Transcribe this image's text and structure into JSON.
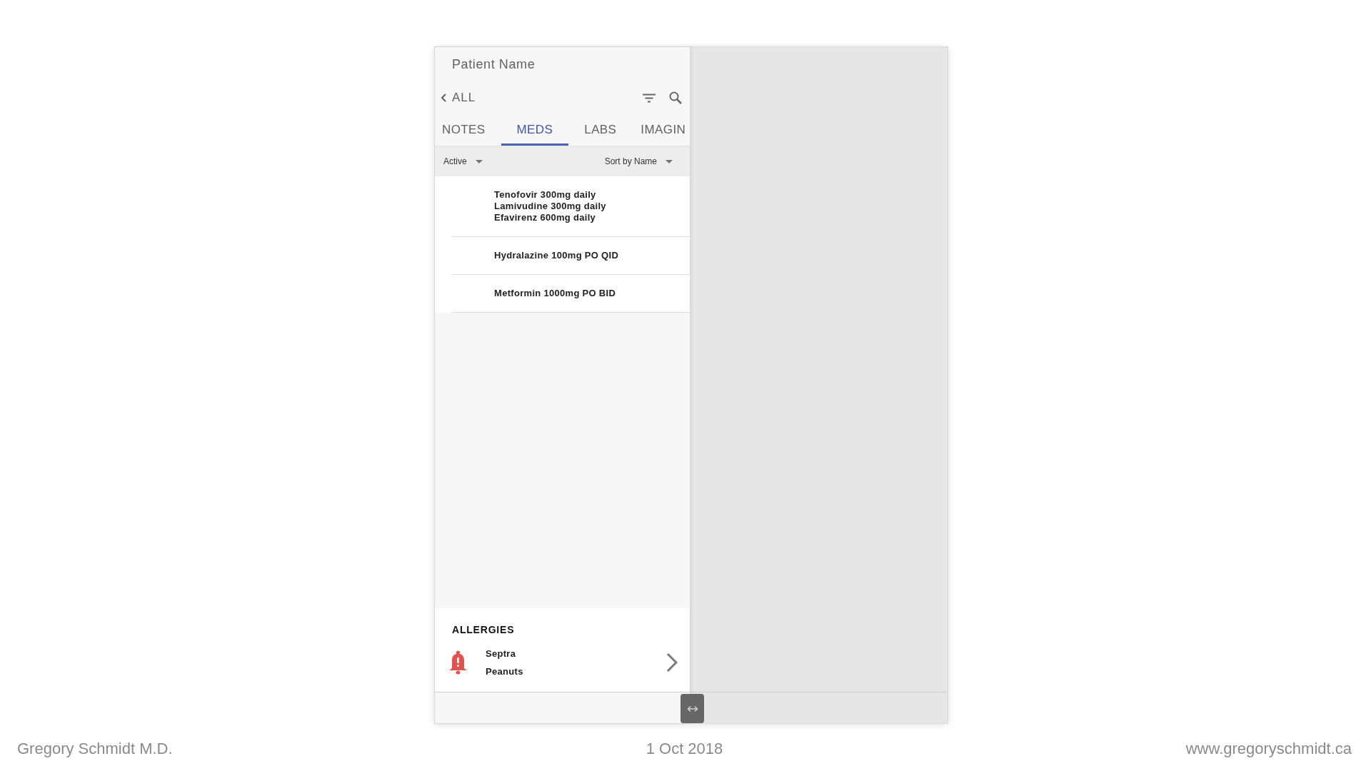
{
  "header": {
    "title": "Patient Name"
  },
  "toolbar": {
    "back_label": "ALL"
  },
  "tabs": [
    {
      "label": "NOTES",
      "selected": false
    },
    {
      "label": "MEDS",
      "selected": true
    },
    {
      "label": "LABS",
      "selected": false
    },
    {
      "label": "IMAGIN",
      "selected": false
    }
  ],
  "filters": {
    "status": "Active",
    "sort": "Sort by Name"
  },
  "medications": [
    {
      "lines": [
        "Tenofovir 300mg daily",
        "Lamivudine 300mg daily",
        "Efavirenz 600mg daily"
      ]
    },
    {
      "lines": [
        "Hydralazine 100mg PO QID"
      ]
    },
    {
      "lines": [
        "Metformin 1000mg PO BID"
      ]
    }
  ],
  "allergies": {
    "heading": "ALLERGIES",
    "items": [
      "Septra",
      "Peanuts"
    ]
  },
  "footer": {
    "author": "Gregory Schmidt M.D.",
    "date": "1 Oct 2018",
    "website": "www.gregoryschmidt.ca"
  }
}
